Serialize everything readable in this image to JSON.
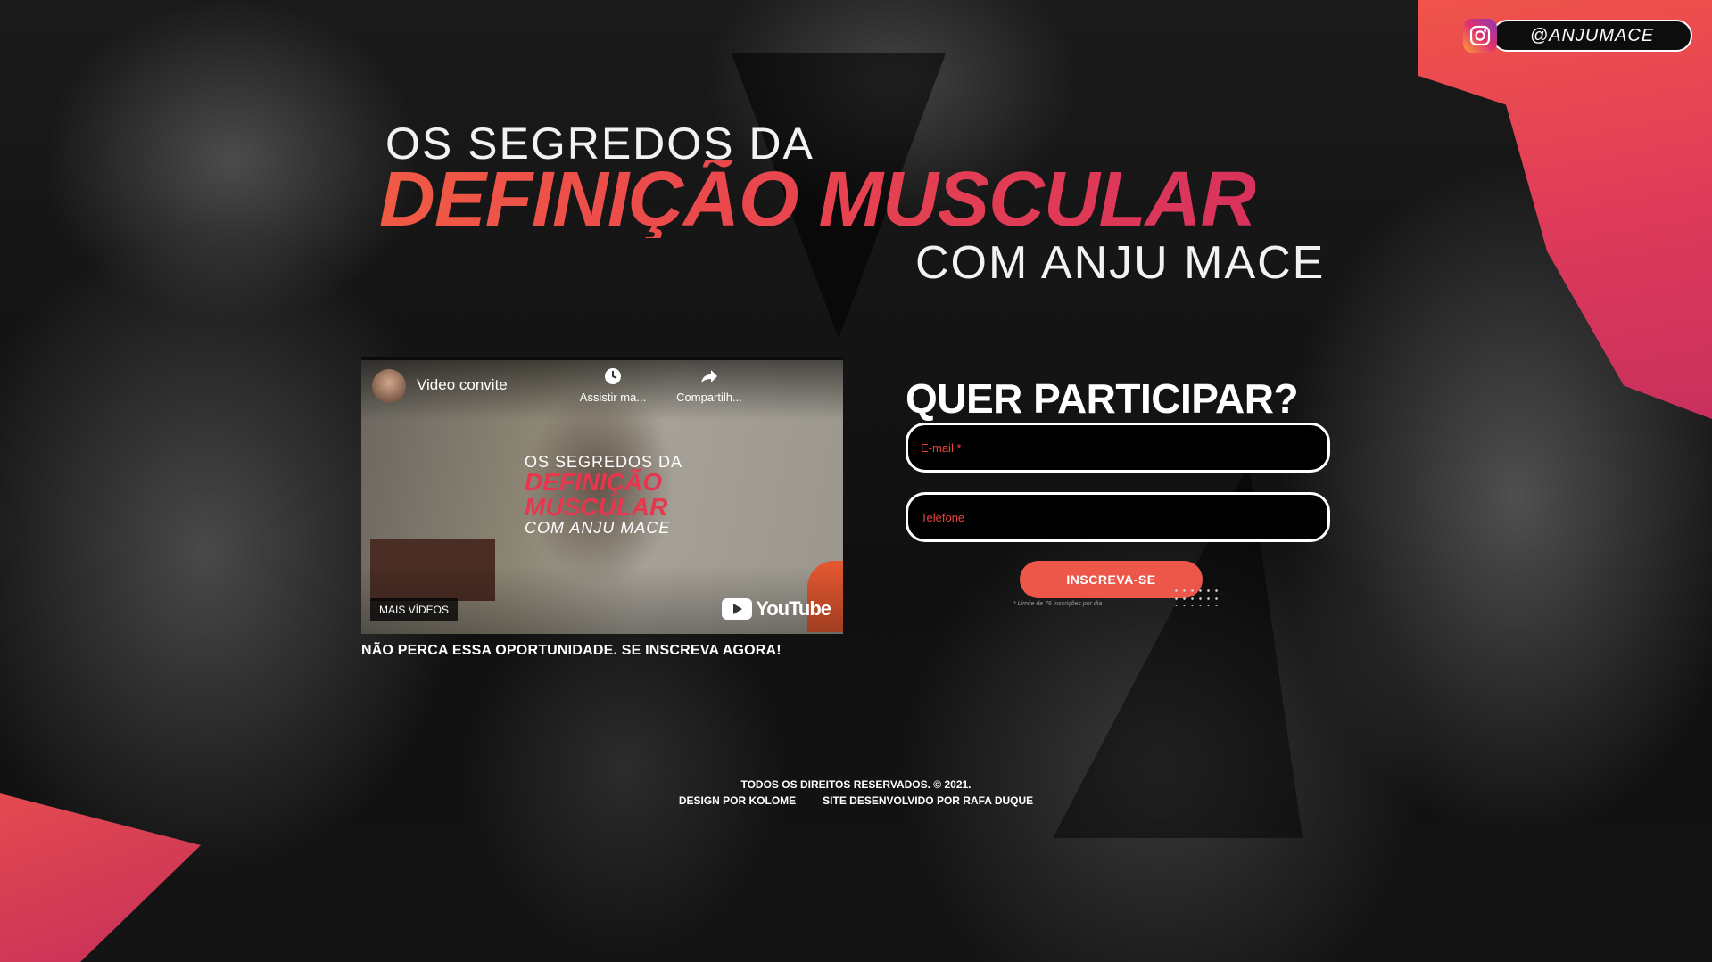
{
  "social": {
    "handle": "@ANJUMACE",
    "icon": "instagram-icon"
  },
  "headline": {
    "top": "OS SEGREDOS DA",
    "main": "DEFINIÇÃO MUSCULAR",
    "bottom": "COM ANJU MACE"
  },
  "video": {
    "title": "Video convite",
    "watch_later": "Assistir ma...",
    "share": "Compartilh...",
    "overlay_top": "OS SEGREDOS DA",
    "overlay_mid1": "DEFINIÇÃO",
    "overlay_mid2": "MUSCULAR",
    "overlay_bottom": "COM ANJU MACE",
    "more_videos": "MAIS VÍDEOS",
    "brand": "YouTube"
  },
  "cta": "NÃO PERCA ESSA OPORTUNIDADE. SE INSCREVA AGORA!",
  "form": {
    "title": "QUER PARTICIPAR?",
    "email_placeholder": "E-mail *",
    "phone_placeholder": "Telefone",
    "submit_label": "INSCREVA-SE",
    "limit_note": "* Limite de 75 inscrições por dia"
  },
  "footer": {
    "rights": "TODOS OS DIREITOS RESERVADOS. © 2021.",
    "design": "DESIGN POR KOLOME",
    "dev": "SITE DESENVOLVIDO POR RAFA DUQUE"
  },
  "colors": {
    "accent": "#ec574a",
    "accent_dark": "#d8325c",
    "background": "#141214"
  }
}
